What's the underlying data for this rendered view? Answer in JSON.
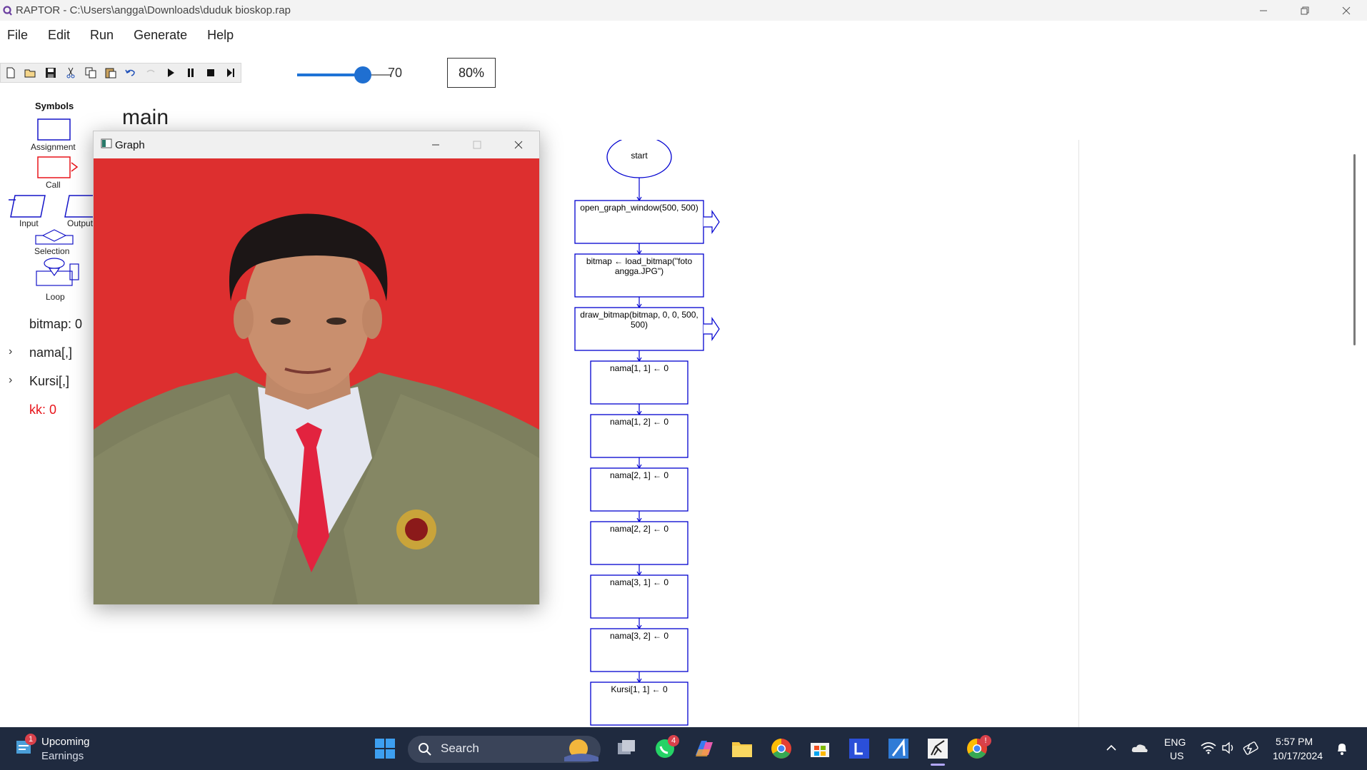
{
  "window": {
    "title": "RAPTOR - C:\\Users\\angga\\Downloads\\duduk bioskop.rap",
    "minimize_icon": "minimize-icon",
    "restore_icon": "restore-icon",
    "close_icon": "close-icon"
  },
  "menu": [
    "File",
    "Edit",
    "Run",
    "Generate",
    "Help"
  ],
  "toolbar": {
    "icons": [
      "new-file-icon",
      "open-folder-icon",
      "save-icon",
      "cut-icon",
      "copy-icon",
      "paste-icon",
      "undo-icon",
      "redo-icon",
      "play-icon",
      "pause-icon",
      "stop-icon",
      "step-icon"
    ],
    "speed_value": "70",
    "speed_fraction": 0.7,
    "zoom": "80%"
  },
  "symbols": {
    "title": "Symbols",
    "items": [
      "Assignment",
      "Call",
      "Input",
      "Output",
      "Selection",
      "Loop"
    ]
  },
  "variables": [
    {
      "label": "bitmap: 0",
      "expandable": false,
      "color": "#222222"
    },
    {
      "label": "nama[,]",
      "expandable": true,
      "color": "#222222"
    },
    {
      "label": "Kursi[,]",
      "expandable": true,
      "color": "#222222"
    },
    {
      "label": "kk: 0",
      "expandable": false,
      "color": "#e8141a"
    }
  ],
  "tab": {
    "name": "main"
  },
  "graph_window": {
    "title": "Graph",
    "background": "#dd2f2f"
  },
  "flowchart": {
    "start": "start",
    "steps": [
      "open_graph_window(500, 500)",
      "bitmap ← load_bitmap(\"foto angga.JPG\")",
      "draw_bitmap(bitmap, 0, 0, 500, 500)",
      "nama[1, 1] ← 0",
      "nama[1, 2] ← 0",
      "nama[2, 1] ← 0",
      "nama[2, 2] ← 0",
      "nama[3, 1] ← 0",
      "nama[3, 2] ← 0",
      "Kursi[1, 1] ← 0"
    ],
    "color": "#0000d0"
  },
  "taskbar": {
    "weather_title": "Upcoming",
    "weather_sub": "Earnings",
    "weather_badge": "1",
    "search": "Search",
    "whatsapp_badge": "4",
    "chrome_badge": "!",
    "lang_top": "ENG",
    "lang_bottom": "US",
    "time": "5:57 PM",
    "date": "10/17/2024"
  }
}
